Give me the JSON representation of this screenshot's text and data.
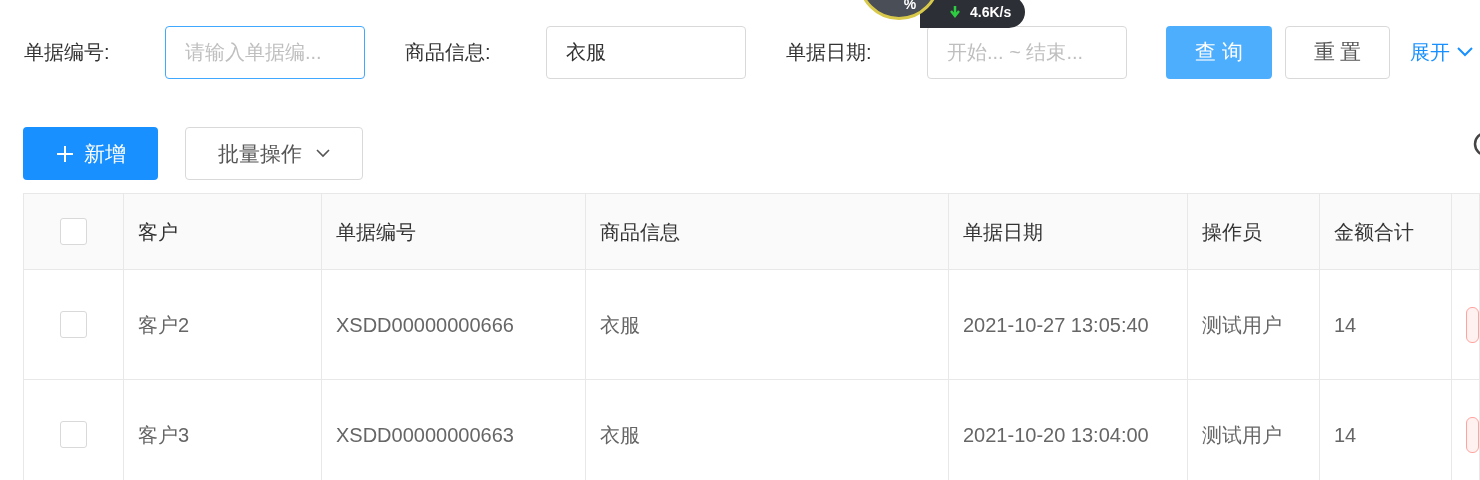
{
  "filters": [
    {
      "label": "单据编号:",
      "placeholder": "请输入单据编...",
      "focused": true
    },
    {
      "label": "商品信息:",
      "value": "衣服",
      "focused": false
    },
    {
      "label": "单据日期:",
      "placeholder": "开始... ~ 结束...",
      "focused": false
    }
  ],
  "query_button": "查 询",
  "reset_button": "重 置",
  "expand_link": "展开",
  "speed_widget": {
    "percent": "%",
    "speed": "4.6K/s"
  },
  "toolbar": {
    "add_button": "新增",
    "batch_button": "批量操作"
  },
  "table": {
    "columns": [
      "客户",
      "单据编号",
      "商品信息",
      "单据日期",
      "操作员",
      "金额合计"
    ],
    "header_checked": false,
    "rows": [
      {
        "checked": false,
        "cells": [
          "客户2",
          "XSDD00000000666",
          "衣服",
          "2021-10-27 13:05:40",
          "测试用户",
          "14"
        ]
      },
      {
        "checked": false,
        "cells": [
          "客户3",
          "XSDD00000000663",
          "衣服",
          "2021-10-20 13:04:00",
          "测试用户",
          "14"
        ]
      }
    ]
  }
}
